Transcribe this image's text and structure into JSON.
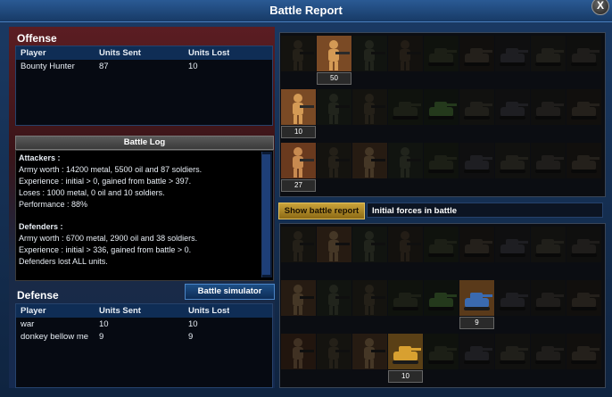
{
  "window": {
    "title": "Battle Report",
    "close_label": "X"
  },
  "offense": {
    "title": "Offense",
    "headers": [
      "Player",
      "Units Sent",
      "Units Lost"
    ],
    "rows": [
      [
        "Bounty Hunter",
        "87",
        "10"
      ]
    ]
  },
  "battle_log": {
    "title": "Battle Log",
    "lines": [
      "Attackers :",
      "Army worth : 14200 metal, 5500 oil and 87 soldiers.",
      "Experience : initial > 0, gained from battle > 397.",
      "Loses : 1000 metal, 0 oil and 10 soldiers.",
      "Performance : 88%",
      "",
      "Defenders :",
      "Army worth : 6700 metal, 2900 oil and 38 soldiers.",
      "Experience : initial > 336, gained from battle > 0.",
      "Defenders lost ALL units."
    ]
  },
  "defense": {
    "title": "Defense",
    "headers": [
      "Player",
      "Units Sent",
      "Units Lost"
    ],
    "rows": [
      [
        "war",
        "10",
        "10"
      ],
      [
        "donkey bellow me",
        "9",
        "9"
      ]
    ]
  },
  "buttons": {
    "battle_simulator": "Battle simulator",
    "show_battle_report": "Show battle report"
  },
  "initial_forces_label": "Initial forces in battle",
  "attacker_units": [
    [
      {
        "type": "infantry-rifle"
      },
      {
        "type": "infantry-heavy",
        "count": "50"
      },
      {
        "type": "infantry-sniper"
      },
      {
        "type": "infantry-gunner"
      },
      {
        "type": "tank"
      },
      {
        "type": "mech"
      },
      {
        "type": "artillery"
      },
      {
        "type": "heavy-tank"
      },
      {
        "type": "walker"
      }
    ],
    [
      {
        "type": "infantry-heavy",
        "count": "10"
      },
      {
        "type": "infantry-sniper"
      },
      {
        "type": "infantry-rifle"
      },
      {
        "type": "tank"
      },
      {
        "type": "tank-laser"
      },
      {
        "type": "heavy-tank"
      },
      {
        "type": "artillery"
      },
      {
        "type": "walker"
      },
      {
        "type": "mech"
      }
    ],
    [
      {
        "type": "infantry-rocket",
        "count": "27"
      },
      {
        "type": "infantry-rifle"
      },
      {
        "type": "infantry-heavy"
      },
      {
        "type": "infantry-sniper"
      },
      {
        "type": "tank"
      },
      {
        "type": "artillery"
      },
      {
        "type": "heavy-tank"
      },
      {
        "type": "walker"
      },
      {
        "type": "mech"
      }
    ]
  ],
  "defender_units": [
    [
      {
        "type": "infantry-rifle"
      },
      {
        "type": "infantry-heavy"
      },
      {
        "type": "infantry-sniper"
      },
      {
        "type": "infantry-gunner"
      },
      {
        "type": "tank"
      },
      {
        "type": "mech"
      },
      {
        "type": "artillery"
      },
      {
        "type": "heavy-tank"
      },
      {
        "type": "walker"
      }
    ],
    [
      {
        "type": "infantry-heavy"
      },
      {
        "type": "infantry-sniper"
      },
      {
        "type": "infantry-rifle"
      },
      {
        "type": "tank"
      },
      {
        "type": "tank-laser"
      },
      {
        "type": "assault-vehicle",
        "count": "9"
      },
      {
        "type": "artillery"
      },
      {
        "type": "walker"
      },
      {
        "type": "mech"
      }
    ],
    [
      {
        "type": "infantry-rocket"
      },
      {
        "type": "infantry-rifle"
      },
      {
        "type": "infantry-heavy"
      },
      {
        "type": "scorpion-tank",
        "count": "10"
      },
      {
        "type": "tank"
      },
      {
        "type": "artillery"
      },
      {
        "type": "heavy-tank"
      },
      {
        "type": "walker"
      },
      {
        "type": "mech"
      }
    ]
  ],
  "colors": {
    "offense_bg": "#5b1d22",
    "defense_bg": "#152a50",
    "accent_gold": "#caa33a",
    "header_blue": "#0f2d55"
  }
}
